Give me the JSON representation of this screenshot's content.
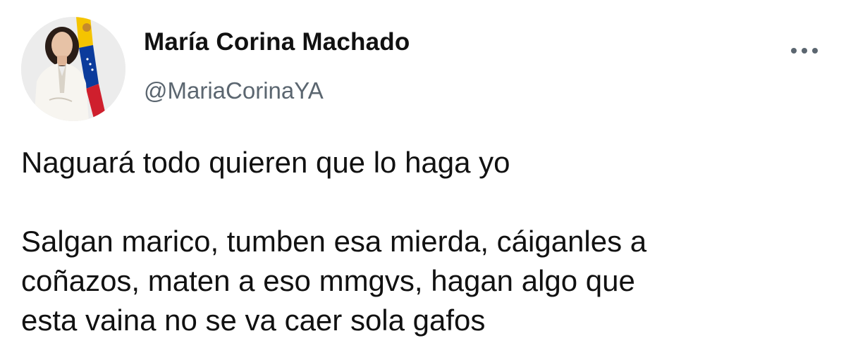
{
  "author": {
    "display_name": "María Corina Machado",
    "handle": "@MariaCorinaYA",
    "avatar_icon": "profile-photo-with-flag",
    "flag_colors": [
      "#f5c400",
      "#0b3b9c",
      "#cf1f2d"
    ]
  },
  "more_icon": "more-options-icon",
  "tweet": {
    "paragraph_1": "Naguará todo quieren que lo haga yo",
    "paragraph_2_lines": [
      "Salgan marico, tumben esa mierda, cáiganles a",
      "coñazos, maten a eso mmgvs, hagan algo que",
      "esta vaina no se va caer sola gafos"
    ]
  }
}
